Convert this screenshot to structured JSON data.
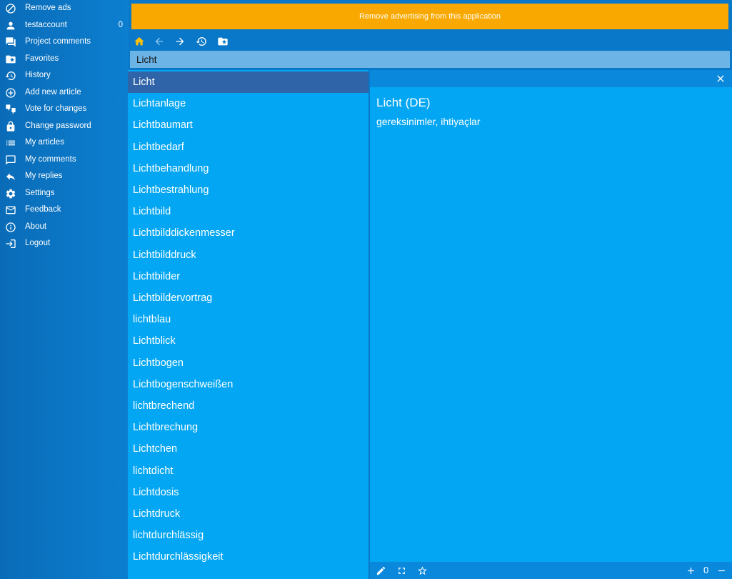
{
  "sidebar": {
    "items": [
      {
        "id": "remove-ads",
        "label": "Remove ads",
        "icon": "block-icon"
      },
      {
        "id": "account",
        "label": "testaccount",
        "icon": "person-icon",
        "count": "0"
      },
      {
        "id": "project-comments",
        "label": "Project comments",
        "icon": "forum-icon"
      },
      {
        "id": "favorites",
        "label": "Favorites",
        "icon": "favorite-folder-icon"
      },
      {
        "id": "history",
        "label": "History",
        "icon": "history-icon"
      },
      {
        "id": "add-new-article",
        "label": "Add new article",
        "icon": "add-circle-icon"
      },
      {
        "id": "vote-for-changes",
        "label": "Vote for changes",
        "icon": "thumbs-icon"
      },
      {
        "id": "change-password",
        "label": "Change password",
        "icon": "lock-icon"
      },
      {
        "id": "my-articles",
        "label": "My articles",
        "icon": "list-icon"
      },
      {
        "id": "my-comments",
        "label": "My comments",
        "icon": "comment-icon"
      },
      {
        "id": "my-replies",
        "label": "My replies",
        "icon": "reply-icon"
      },
      {
        "id": "settings",
        "label": "Settings",
        "icon": "gear-icon"
      },
      {
        "id": "feedback",
        "label": "Feedback",
        "icon": "mail-icon"
      },
      {
        "id": "about",
        "label": "About",
        "icon": "info-icon"
      },
      {
        "id": "logout",
        "label": "Logout",
        "icon": "logout-icon"
      }
    ]
  },
  "ad_banner": {
    "text": "Remove advertising from this application",
    "color": "#f9a800"
  },
  "toolbar": {
    "icons": [
      "home-icon",
      "back-arrow-icon",
      "forward-arrow-icon",
      "history-icon",
      "favorite-folder-icon"
    ],
    "home_color": "#ffc107"
  },
  "search": {
    "value": "Licht",
    "placeholder": ""
  },
  "word_list": {
    "selected_index": 0,
    "items": [
      "Licht",
      "Lichtanlage",
      "Lichtbaumart",
      "Lichtbedarf",
      "Lichtbehandlung",
      "Lichtbestrahlung",
      "Lichtbild",
      "Lichtbilddickenmesser",
      "Lichtbilddruck",
      "Lichtbilder",
      "Lichtbildervortrag",
      "lichtblau",
      "Lichtblick",
      "Lichtbogen",
      "Lichtbogenschweißen",
      "lichtbrechend",
      "Lichtbrechung",
      "Lichtchen",
      "lichtdicht",
      "Lichtdosis",
      "Lichtdruck",
      "lichtdurchlässig",
      "Lichtdurchlässigkeit"
    ]
  },
  "detail": {
    "title": "Licht (DE)",
    "translation": "gereksinimler, ihtiyaçlar"
  },
  "bottom_bar": {
    "icons": [
      "edit-icon",
      "fullscreen-icon",
      "star-outline-icon",
      "plus-icon",
      "minus-icon"
    ],
    "zoom": "0"
  },
  "colors": {
    "sidebar": "#0a6cb8",
    "list_background": "#03a6f2",
    "selected_row": "#3064a8",
    "search_background": "#6cb4e6"
  }
}
